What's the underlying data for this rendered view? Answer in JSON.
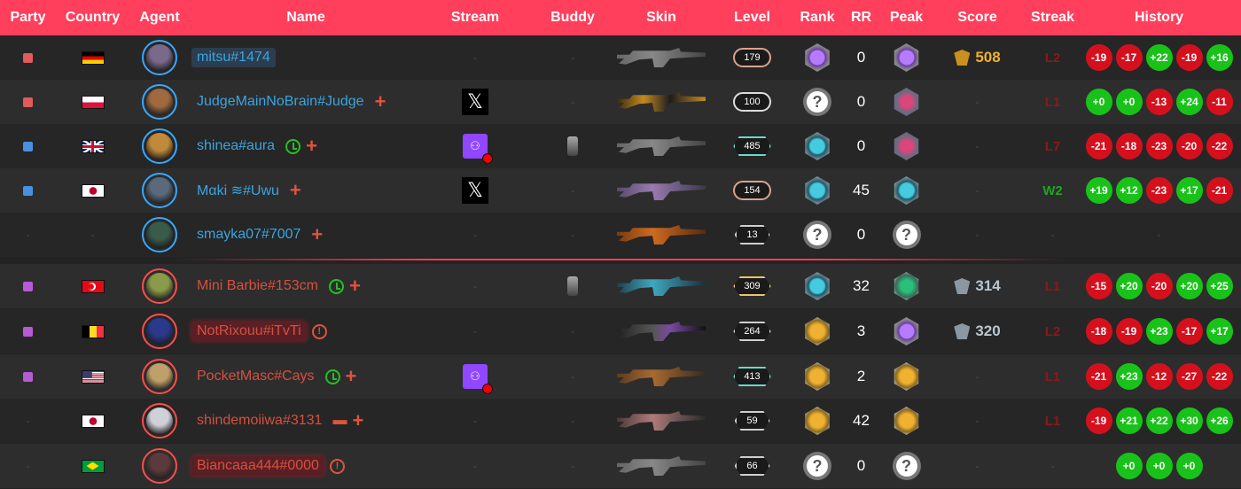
{
  "headers": {
    "party": "Party",
    "country": "Country",
    "agent": "Agent",
    "name": "Name",
    "stream": "Stream",
    "buddy": "Buddy",
    "skin": "Skin",
    "level": "Level",
    "rank": "Rank",
    "rr": "RR",
    "peak": "Peak",
    "score": "Score",
    "streak": "Streak",
    "history": "History"
  },
  "empty_marker": "-",
  "unranked_symbol": "?",
  "x_symbol": "𝕏",
  "twitch_symbol": "⚇",
  "players": [
    {
      "party_color": "#e25a5a",
      "country": "de",
      "agent_color": "#7a6a8a",
      "name": "mitsu#1474",
      "name_style": "blue bg-blue",
      "extras": [],
      "stream": null,
      "buddy": false,
      "skin": "grey",
      "level": "179",
      "level_style": "",
      "rank": "amethyst",
      "rr": "0",
      "peak": "amethyst",
      "score": "508",
      "score_style": "gold",
      "streak": "L2",
      "streak_style": "loss",
      "history": [
        "-19",
        "-17",
        "+22",
        "-19",
        "+16"
      ]
    },
    {
      "party_color": "#e25a5a",
      "country": "pl",
      "agent_color": "#a06a40",
      "name": "JudgeMainNoBrain#Judge",
      "name_style": "blue",
      "extras": [
        "plus"
      ],
      "stream": "x",
      "buddy": false,
      "skin": "gold",
      "level": "100",
      "level_style": "white",
      "rank": "unranked",
      "rr": "0",
      "peak": "crystal",
      "score": null,
      "score_style": "",
      "streak": "L1",
      "streak_style": "loss",
      "history": [
        "+0",
        "+0",
        "-13",
        "+24",
        "-11"
      ]
    },
    {
      "party_color": "#4a90e2",
      "country": "gb",
      "agent_color": "#c08a3a",
      "name": "shinea#aura",
      "name_style": "blue",
      "extras": [
        "history",
        "plus"
      ],
      "stream": "twitch",
      "buddy": true,
      "skin": "grey",
      "level": "485",
      "level_style": "teal",
      "rank": "diamond",
      "rr": "0",
      "peak": "crystal",
      "score": null,
      "score_style": "",
      "streak": "L7",
      "streak_style": "loss",
      "history": [
        "-21",
        "-18",
        "-23",
        "-20",
        "-22"
      ]
    },
    {
      "party_color": "#4a90e2",
      "country": "jp",
      "agent_color": "#5a6a7a",
      "name": "Mαki ≋#Uwu",
      "name_style": "blue",
      "extras": [
        "plus"
      ],
      "stream": "x",
      "buddy": false,
      "skin": "purple",
      "level": "154",
      "level_style": "",
      "rank": "diamond",
      "rr": "45",
      "peak": "diamond",
      "score": null,
      "score_style": "",
      "streak": "W2",
      "streak_style": "win",
      "history": [
        "+19",
        "+12",
        "-23",
        "+17",
        "-21"
      ]
    },
    {
      "party_color": null,
      "country": null,
      "agent_color": "#3a5a4a",
      "name": "smayka07#7007",
      "name_style": "blue",
      "extras": [
        "plus"
      ],
      "stream": null,
      "buddy": false,
      "skin": "orange",
      "level": "13",
      "level_style": "silverhex",
      "rank": "unranked",
      "rr": "0",
      "peak": "unranked",
      "score": null,
      "score_style": "",
      "streak": null,
      "streak_style": "",
      "history": []
    },
    {
      "party_color": "#b65ad6",
      "country": "tr",
      "agent_color": "#8a9a4a",
      "name": "Mini Barbie#153cm",
      "name_style": "red",
      "extras": [
        "history",
        "plus"
      ],
      "stream": null,
      "buddy": true,
      "skin": "teal",
      "level": "309",
      "level_style": "goldhex",
      "rank": "diamond",
      "rr": "32",
      "peak": "emerald",
      "score": "314",
      "score_style": "silver",
      "streak": "L1",
      "streak_style": "loss",
      "history": [
        "-15",
        "+20",
        "-20",
        "+20",
        "+25"
      ]
    },
    {
      "party_color": "#b65ad6",
      "country": "be",
      "agent_color": "#2a3a8a",
      "name": "NotRixouu#iTvTi",
      "name_style": "red bg-red",
      "extras": [
        "warn"
      ],
      "stream": null,
      "buddy": false,
      "skin": "dark",
      "level": "264",
      "level_style": "silverhex",
      "rank": "gold",
      "rr": "3",
      "peak": "amethyst",
      "score": "320",
      "score_style": "silver",
      "streak": "L2",
      "streak_style": "loss",
      "history": [
        "-18",
        "-19",
        "+23",
        "-17",
        "+17"
      ]
    },
    {
      "party_color": "#b65ad6",
      "country": "us",
      "agent_color": "#c0a06a",
      "name": "PocketMasc#Cays",
      "name_style": "red",
      "extras": [
        "history",
        "plus"
      ],
      "stream": "twitch",
      "buddy": false,
      "skin": "rust",
      "level": "413",
      "level_style": "teal",
      "rank": "gold",
      "rr": "2",
      "peak": "gold",
      "score": null,
      "score_style": "",
      "streak": "L1",
      "streak_style": "loss",
      "history": [
        "-21",
        "+23",
        "-12",
        "-27",
        "-22"
      ]
    },
    {
      "party_color": null,
      "country": "jp",
      "agent_color": "#d0d0d8",
      "name": "shindemoiiwa#3131",
      "name_style": "red",
      "extras": [
        "mask",
        "plus"
      ],
      "stream": null,
      "buddy": false,
      "skin": "pink",
      "level": "59",
      "level_style": "silverhex",
      "rank": "gold",
      "rr": "42",
      "peak": "gold",
      "score": null,
      "score_style": "",
      "streak": "L1",
      "streak_style": "loss",
      "history": [
        "-19",
        "+21",
        "+22",
        "+30",
        "+26"
      ]
    },
    {
      "party_color": null,
      "country": "br",
      "agent_color": "#5a3a3a",
      "name": "Biancaaa444#0000",
      "name_style": "red bg-red",
      "extras": [
        "warn"
      ],
      "stream": null,
      "buddy": false,
      "skin": "grey",
      "level": "66",
      "level_style": "silverhex",
      "rank": "unranked",
      "rr": "0",
      "peak": "unranked",
      "score": null,
      "score_style": "",
      "streak": null,
      "streak_style": "",
      "history": [
        "+0",
        "+0",
        "+0"
      ]
    }
  ]
}
